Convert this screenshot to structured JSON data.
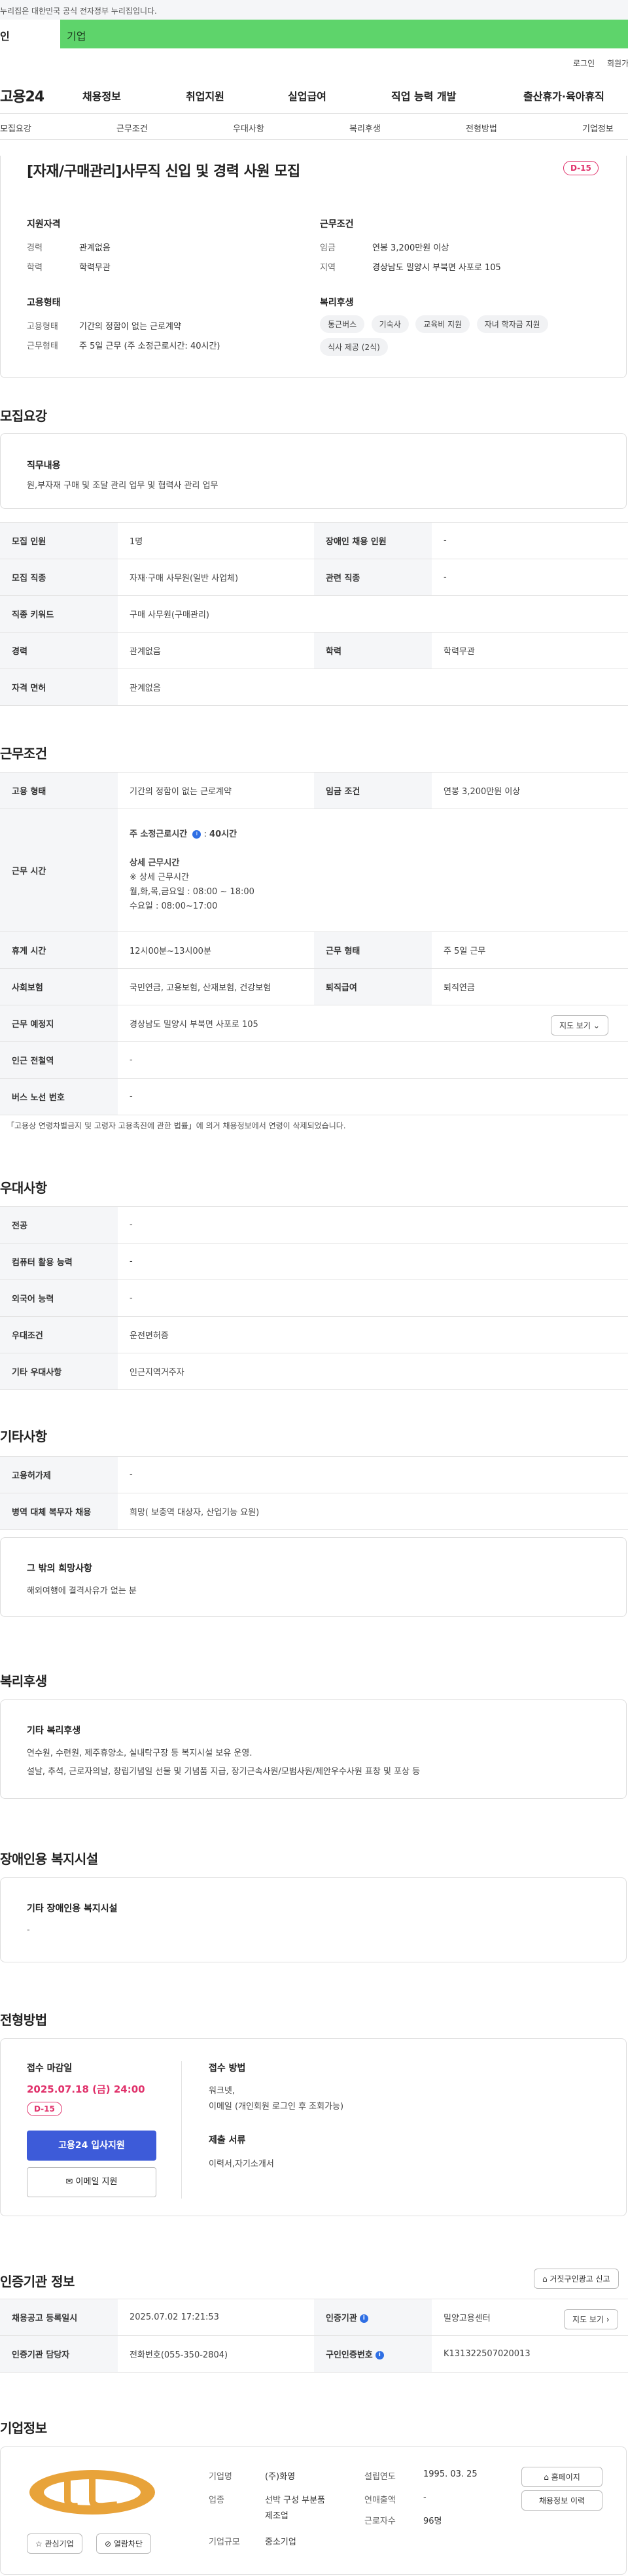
{
  "gov_banner": "누리집은 대한민국 공식 전자정부 누리집입니다.",
  "audience_tabs": [
    "인",
    "기업"
  ],
  "util": {
    "login": "로그인",
    "join": "회원가"
  },
  "gnb": {
    "logo": "고용24",
    "menus": [
      "채용정보",
      "취업지원",
      "실업급여",
      "직업 능력 개발",
      "출산휴가·육아휴직"
    ]
  },
  "lnb": [
    "모집요강",
    "근무조건",
    "우대사항",
    "복리후생",
    "전형방법",
    "기업정보"
  ],
  "job": {
    "title": "[자재/구매관리]사무직 신입 및 경력 사원 모집",
    "dday": "D-15",
    "qualify_h": "지원자격",
    "career_k": "경력",
    "career_v": "관계없음",
    "edu_k": "학력",
    "edu_v": "학력무관",
    "employ_h": "고용형태",
    "etype_k": "고용형태",
    "etype_v": "기간의 정함이 없는 근로계약",
    "wtype_k": "근무형태",
    "wtype_v": "주 5일 근무 (주 소정근로시간: 40시간)",
    "cond_h": "근무조건",
    "wage_k": "임금",
    "wage_v": "연봉 3,200만원 이상",
    "region_k": "지역",
    "region_v": "경상남도 밀양시 부북면 사포로 105",
    "welfare_h": "복리후생",
    "welfare_tags": [
      "통근버스",
      "기숙사",
      "교육비 지원",
      "자녀 학자금 지원",
      "식사 제공 (2식)"
    ]
  },
  "recruit": {
    "heading": "모집요강",
    "duty_h": "직무내용",
    "duty_v": "원,부자재 구매 및 조달 관리 업무 및 협력사 관리 업무",
    "rows": [
      [
        "모집 인원",
        "1명",
        "장애인 채용 인원",
        "-"
      ],
      [
        "모집 직종",
        "자재·구매 사무원(일반 사업체)",
        "관련 직종",
        "-"
      ],
      [
        "직종 키워드",
        "구매 사무원(구매관리)"
      ],
      [
        "경력",
        "관계없음",
        "학력",
        "학력무관"
      ],
      [
        "자격 면허",
        "관계없음"
      ]
    ]
  },
  "work": {
    "heading": "근무조건",
    "emp_k": "고용 형태",
    "emp_v": "기간의 정함이 없는 근로계약",
    "wage_k": "임금 조건",
    "wage_v": "연봉 3,200만원 이상",
    "time_k": "근무 시간",
    "time_lines": [
      "주 소정근로시간",
      "40시간",
      "상세 근무시간",
      "※ 상세 근무시간",
      "월,화,목,금요일 : 08:00 ~ 18:00",
      "수요일 : 08:00~17:00"
    ],
    "break_k": "휴게 시간",
    "break_v": "12시00분~13시00분",
    "wtype_k": "근무 형태",
    "wtype_v": "주 5일 근무",
    "ins_k": "사회보험",
    "ins_v": "국민연금, 고용보험, 산재보험, 건강보험",
    "ret_k": "퇴직급여",
    "ret_v": "퇴직연금",
    "place_k": "근무 예정지",
    "place_v": "경상남도 밀양시 부북면 사포로 105",
    "map_btn": "지도 보기",
    "subway_k": "인근 전철역",
    "subway_v": "-",
    "bus_k": "버스 노선 번호",
    "bus_v": "-",
    "note": "「고용상 연령차별금지 및 고령자 고용촉진에 관한 법률」에 의거 채용정보에서 연령이 삭제되었습니다."
  },
  "prefer": {
    "heading": "우대사항",
    "rows": [
      [
        "전공",
        "-"
      ],
      [
        "컴퓨터 활용 능력",
        "-"
      ],
      [
        "외국어 능력",
        "-"
      ],
      [
        "우대조건",
        "운전면허증"
      ],
      [
        "기타 우대사항",
        "인근지역거주자"
      ]
    ]
  },
  "etc": {
    "heading": "기타사항",
    "rows": [
      [
        "고용허가제",
        "-"
      ],
      [
        "병역 대체 복무자 채용",
        "희망( 보충역 대상자, 산업기능 요원)"
      ]
    ],
    "extra_h": "그 밖의 희망사항",
    "extra_v": "해외여행에 결격사유가 없는 분"
  },
  "welfare": {
    "heading": "복리후생",
    "sub_h": "기타 복리후생",
    "lines": [
      "연수원, 수련원, 제주휴양소, 실내탁구장 등 복지시설 보유 운영.",
      "설날, 추석, 근로자의날, 창립기념일 선물 및 기념품 지급, 장기근속사원/모범사원/제안우수사원 표창 및 포상 등"
    ]
  },
  "disabled": {
    "heading": "장애인용 복지시설",
    "sub_h": "기타 장애인용 복지시설",
    "value": "-"
  },
  "process": {
    "heading": "전형방법",
    "deadline_h": "접수 마감일",
    "deadline_v": "2025.07.18 (금) 24:00",
    "dday": "D-15",
    "apply_btn": "고용24 입사지원",
    "email_btn": "이메일 지원",
    "method_h": "접수 방법",
    "method_lines": [
      "워크넷,",
      "이메일 (개인회원 로그인 후 조회가능)"
    ],
    "docs_h": "제출 서류",
    "docs_v": "이력서,자기소개서"
  },
  "cert": {
    "heading": "인증기관 정보",
    "report_btn": "거짓구인광고 신고",
    "rows": [
      [
        "채용공고 등록일시",
        "2025.07.02 17:21:53",
        "인증기관",
        "밀양고용센터"
      ],
      [
        "인증기관 담당자",
        "전화번호(055-350-2804)",
        "구인인증번호",
        "K131322507020013"
      ]
    ],
    "map_btn": "지도 보기"
  },
  "company": {
    "heading": "기업정보",
    "fav_btn": "관심기업",
    "block_btn": "열람차단",
    "name_k": "기업명",
    "name_v": "(주)화영",
    "ind_k": "업종",
    "ind_v": [
      "선박 구성 부분품",
      "제조업"
    ],
    "size_k": "기업규모",
    "size_v": "중소기업",
    "est_k": "설립연도",
    "est_v": "1995. 03. 25",
    "sales_k": "연매출액",
    "sales_v": "-",
    "emp_k": "근로자수",
    "emp_v": "96명",
    "home_btn": "홈페이지",
    "hist_btn": "채용정보 이력"
  },
  "colors": {
    "primary": "#3d5bd9",
    "dday": "#e0306a",
    "tab": "#5ed46b",
    "logo": "#e8a33a",
    "deadline": "#e0306a"
  }
}
